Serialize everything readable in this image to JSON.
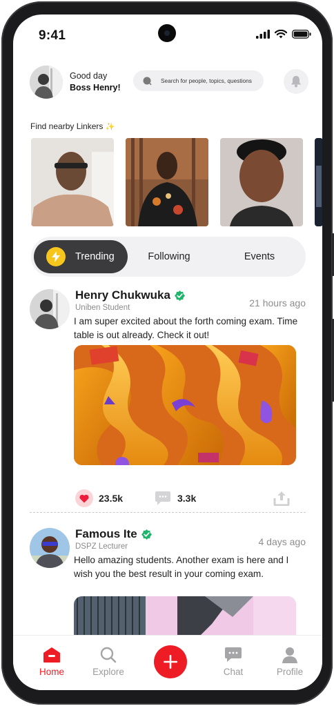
{
  "status_bar": {
    "time": "9:41"
  },
  "header": {
    "greeting": "Good day",
    "user_name": "Boss Henry!",
    "search_placeholder": "Search for people, topics, questions"
  },
  "nearby": {
    "title": "Find nearby Linkers",
    "people_count_shown": 4
  },
  "tabs": [
    {
      "label": "Trending",
      "active": true
    },
    {
      "label": "Following",
      "active": false
    },
    {
      "label": "Events",
      "active": false
    }
  ],
  "posts": [
    {
      "author": "Henry Chukwuka",
      "verified": true,
      "role": "Uniben Student",
      "time": "21 hours ago",
      "text": "I am super excited about the forth coming exam. Time table is out already. Check it out!",
      "likes": "23.5k",
      "comments": "3.3k"
    },
    {
      "author": "Famous Ite",
      "verified": true,
      "role": "DSPZ Lecturer",
      "time": "4 days ago",
      "text": "Hello amazing students. Another exam is here and I wish you the best result in your coming exam."
    }
  ],
  "bottom_nav": [
    {
      "label": "Home",
      "active": true,
      "icon": "home-icon"
    },
    {
      "label": "Explore",
      "active": false,
      "icon": "search-icon"
    },
    {
      "label": "Chat",
      "active": false,
      "icon": "chat-icon"
    },
    {
      "label": "Profile",
      "active": false,
      "icon": "profile-icon"
    }
  ],
  "colors": {
    "accent": "#ee1c24",
    "tab_active_bg": "#3b3b3d",
    "bolt": "#f7c61c",
    "verified": "#21b36b"
  }
}
